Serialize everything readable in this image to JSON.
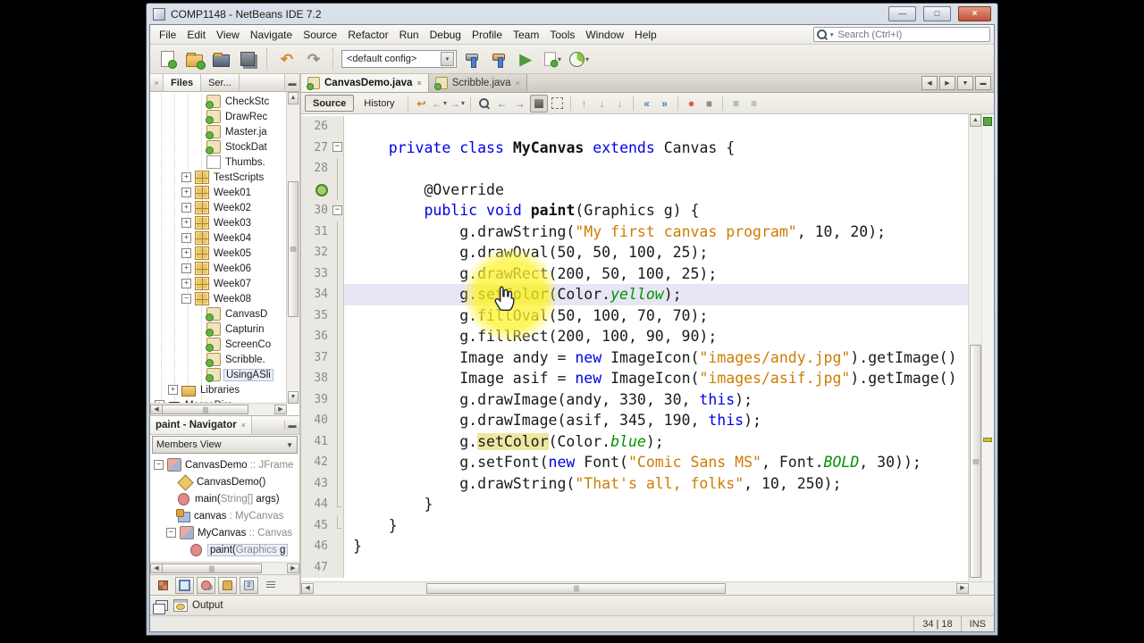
{
  "window": {
    "title": "COMP1148 - NetBeans IDE 7.2"
  },
  "menu": {
    "items": [
      "File",
      "Edit",
      "View",
      "Navigate",
      "Source",
      "Refactor",
      "Run",
      "Debug",
      "Profile",
      "Team",
      "Tools",
      "Window",
      "Help"
    ]
  },
  "search": {
    "placeholder": "Search (Ctrl+I)"
  },
  "toolbar": {
    "config": "<default config>"
  },
  "icons": {
    "minimize": "—",
    "maximize": "□",
    "close": "×",
    "tab_close": "×",
    "combo_arrow": "▾",
    "dropdown_arrow": "▾",
    "scroll_left": "◀",
    "scroll_right": "▶",
    "scroll_up": "▲",
    "scroll_down": "▼",
    "undo": "↶",
    "redo": "↷",
    "run": "▶",
    "last_edit": "↩",
    "back": "←",
    "forward": "→",
    "find_prev": "←",
    "find_next": "→",
    "bookmark_up": "↑",
    "bookmark_down": "↓",
    "shift_left": "«",
    "shift_right": "»",
    "record": "●",
    "stop": "■",
    "comment": "≡",
    "uncomment": "≡",
    "expand_more": "▼"
  },
  "files_panel": {
    "tabs": [
      {
        "label": "Files",
        "active": true
      },
      {
        "label": "Ser...",
        "active": false
      }
    ],
    "tree": [
      {
        "lvl": 3,
        "icon": "jclass",
        "label": "CheckStc"
      },
      {
        "lvl": 3,
        "icon": "jclass",
        "label": "DrawRec"
      },
      {
        "lvl": 3,
        "icon": "jclass",
        "label": "Master.ja"
      },
      {
        "lvl": 3,
        "icon": "jclass",
        "label": "StockDat"
      },
      {
        "lvl": 3,
        "icon": "file",
        "label": "Thumbs."
      },
      {
        "lvl": 2,
        "exp": "+",
        "icon": "pkg",
        "label": "TestScripts"
      },
      {
        "lvl": 2,
        "exp": "+",
        "icon": "pkg",
        "label": "Week01"
      },
      {
        "lvl": 2,
        "exp": "+",
        "icon": "pkg",
        "label": "Week02"
      },
      {
        "lvl": 2,
        "exp": "+",
        "icon": "pkg",
        "label": "Week03"
      },
      {
        "lvl": 2,
        "exp": "+",
        "icon": "pkg",
        "label": "Week04"
      },
      {
        "lvl": 2,
        "exp": "+",
        "icon": "pkg",
        "label": "Week05"
      },
      {
        "lvl": 2,
        "exp": "+",
        "icon": "pkg",
        "label": "Week06"
      },
      {
        "lvl": 2,
        "exp": "+",
        "icon": "pkg",
        "label": "Week07"
      },
      {
        "lvl": 2,
        "exp": "-",
        "icon": "pkg",
        "label": "Week08"
      },
      {
        "lvl": 3,
        "icon": "jrun",
        "label": "CanvasD"
      },
      {
        "lvl": 3,
        "icon": "jrun",
        "label": "Capturin"
      },
      {
        "lvl": 3,
        "icon": "jrun",
        "label": "ScreenCo"
      },
      {
        "lvl": 3,
        "icon": "jrun",
        "label": "Scribble."
      },
      {
        "lvl": 3,
        "icon": "jrun",
        "label": "UsingASli",
        "sel": true
      },
      {
        "lvl": 1,
        "exp": "+",
        "icon": "folder",
        "label": "Libraries"
      },
      {
        "lvl": 0,
        "exp": "+",
        "icon": "coffee",
        "label": "MergeDirs"
      }
    ]
  },
  "navigator": {
    "title": "paint - Navigator",
    "view": "Members View",
    "tree": [
      {
        "lvl": 0,
        "exp": "-",
        "icon": "nclass",
        "parts": [
          [
            "CanvasDemo ",
            "n"
          ],
          [
            ":: JFrame",
            "t"
          ]
        ]
      },
      {
        "lvl": 1,
        "icon": "ctor",
        "parts": [
          [
            "CanvasDemo()",
            "n"
          ]
        ]
      },
      {
        "lvl": 1,
        "icon": "method",
        "parts": [
          [
            "main(",
            "n"
          ],
          [
            "String[]",
            "t"
          ],
          [
            " args)",
            "n"
          ]
        ]
      },
      {
        "lvl": 1,
        "icon": "nfield",
        "parts": [
          [
            "canvas",
            "n"
          ],
          [
            " : MyCanvas",
            "t"
          ]
        ]
      },
      {
        "lvl": 1,
        "exp": "-",
        "icon": "nclass",
        "parts": [
          [
            "MyCanvas ",
            "n"
          ],
          [
            ":: Canvas",
            "t"
          ]
        ]
      },
      {
        "lvl": 2,
        "icon": "method",
        "sel": true,
        "parts": [
          [
            "paint(",
            "n"
          ],
          [
            "Graphics ",
            "t"
          ],
          [
            "g",
            "n"
          ]
        ]
      }
    ]
  },
  "editor": {
    "tabs": [
      {
        "label": "CanvasDemo.java",
        "active": true
      },
      {
        "label": "Scribble.java",
        "active": false
      }
    ],
    "views": [
      "Source",
      "History"
    ],
    "status_cursor": "34 | 18",
    "status_mode": "INS",
    "code": [
      {
        "n": "26",
        "f": "",
        "t": []
      },
      {
        "n": "27",
        "f": "box",
        "t": [
          [
            "    ",
            "p"
          ],
          [
            "private",
            "k"
          ],
          [
            " ",
            "p"
          ],
          [
            "class",
            "k"
          ],
          [
            " ",
            "p"
          ],
          [
            "MyCanvas",
            "B"
          ],
          [
            " ",
            "p"
          ],
          [
            "extends",
            "k"
          ],
          [
            " Canvas {",
            "p"
          ]
        ]
      },
      {
        "n": "28",
        "f": "line",
        "t": []
      },
      {
        "n": "",
        "badge": true,
        "f": "line",
        "t": [
          [
            "        @Override",
            "p"
          ]
        ]
      },
      {
        "n": "30",
        "f": "box",
        "t": [
          [
            "        ",
            "p"
          ],
          [
            "public",
            "k"
          ],
          [
            " ",
            "p"
          ],
          [
            "void",
            "k"
          ],
          [
            " ",
            "p"
          ],
          [
            "paint",
            "B"
          ],
          [
            "(Graphics g) {",
            "p"
          ]
        ]
      },
      {
        "n": "31",
        "f": "line",
        "t": [
          [
            "            g.drawString(",
            "p"
          ],
          [
            "\"My first canvas program\"",
            "s"
          ],
          [
            ", 10, 20);",
            "p"
          ]
        ]
      },
      {
        "n": "32",
        "f": "line",
        "t": [
          [
            "            g.drawOval(50, 50, 100, 25);",
            "p"
          ]
        ]
      },
      {
        "n": "33",
        "f": "line",
        "t": [
          [
            "            g.drawRect(200, 50, 100, 25);",
            "p"
          ]
        ]
      },
      {
        "n": "34",
        "f": "line",
        "cur": true,
        "t": [
          [
            "            g.",
            "p"
          ],
          [
            "setColor",
            "h"
          ],
          [
            "(Color.",
            "p"
          ],
          [
            "yellow",
            "f"
          ],
          [
            ");",
            "p"
          ]
        ]
      },
      {
        "n": "35",
        "f": "line",
        "t": [
          [
            "            g.fillOval(50, 100, 70, 70);",
            "p"
          ]
        ]
      },
      {
        "n": "36",
        "f": "line",
        "t": [
          [
            "            g.fillRect(200, 100, 90, 90);",
            "p"
          ]
        ]
      },
      {
        "n": "37",
        "f": "line",
        "t": [
          [
            "            Image andy = ",
            "p"
          ],
          [
            "new",
            "k"
          ],
          [
            " ImageIcon(",
            "p"
          ],
          [
            "\"images/andy.jpg\"",
            "s"
          ],
          [
            ").getImage()",
            "p"
          ]
        ]
      },
      {
        "n": "38",
        "f": "line",
        "t": [
          [
            "            Image asif = ",
            "p"
          ],
          [
            "new",
            "k"
          ],
          [
            " ImageIcon(",
            "p"
          ],
          [
            "\"images/asif.jpg\"",
            "s"
          ],
          [
            ").getImage()",
            "p"
          ]
        ]
      },
      {
        "n": "39",
        "f": "line",
        "t": [
          [
            "            g.drawImage(andy, 330, 30, ",
            "p"
          ],
          [
            "this",
            "k"
          ],
          [
            ");",
            "p"
          ]
        ]
      },
      {
        "n": "40",
        "f": "line",
        "t": [
          [
            "            g.drawImage(asif, 345, 190, ",
            "p"
          ],
          [
            "this",
            "k"
          ],
          [
            ");",
            "p"
          ]
        ]
      },
      {
        "n": "41",
        "f": "line",
        "t": [
          [
            "            g.",
            "p"
          ],
          [
            "setColor",
            "h"
          ],
          [
            "(Color.",
            "p"
          ],
          [
            "blue",
            "f"
          ],
          [
            ");",
            "p"
          ]
        ]
      },
      {
        "n": "42",
        "f": "line",
        "t": [
          [
            "            g.setFont(",
            "p"
          ],
          [
            "new",
            "k"
          ],
          [
            " Font(",
            "p"
          ],
          [
            "\"Comic Sans MS\"",
            "s"
          ],
          [
            ", Font.",
            "p"
          ],
          [
            "BOLD",
            "f"
          ],
          [
            ", 30));",
            "p"
          ]
        ]
      },
      {
        "n": "43",
        "f": "line",
        "t": [
          [
            "            g.drawString(",
            "p"
          ],
          [
            "\"That's all, folks\"",
            "s"
          ],
          [
            ", 10, 250);",
            "p"
          ]
        ]
      },
      {
        "n": "44",
        "f": "corner",
        "t": [
          [
            "        }",
            "p"
          ]
        ]
      },
      {
        "n": "45",
        "f": "corner",
        "t": [
          [
            "    }",
            "p"
          ]
        ]
      },
      {
        "n": "46",
        "f": "",
        "t": [
          [
            "}",
            "p"
          ]
        ]
      },
      {
        "n": "47",
        "f": "",
        "t": []
      }
    ]
  },
  "output": {
    "label": "Output"
  }
}
